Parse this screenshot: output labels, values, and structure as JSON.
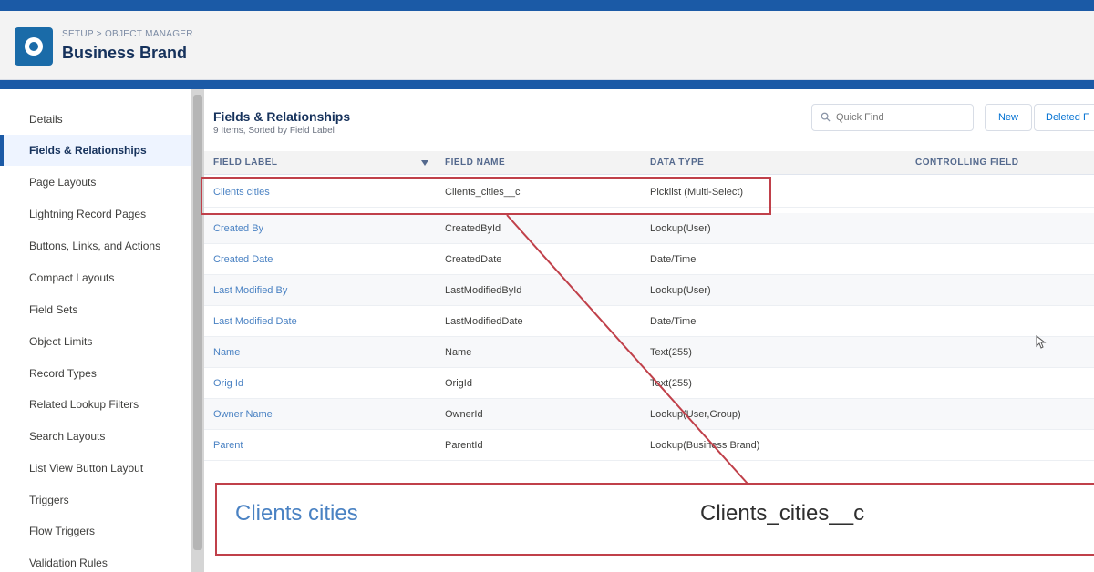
{
  "header": {
    "breadcrumb": "SETUP > OBJECT MANAGER",
    "title": "Business Brand",
    "icon": "object-icon",
    "accent_color": "#1b5aa6"
  },
  "sidebar": {
    "items": [
      {
        "label": "Details"
      },
      {
        "label": "Fields & Relationships",
        "active": true
      },
      {
        "label": "Page Layouts"
      },
      {
        "label": "Lightning Record Pages"
      },
      {
        "label": "Buttons, Links, and Actions"
      },
      {
        "label": "Compact Layouts"
      },
      {
        "label": "Field Sets"
      },
      {
        "label": "Object Limits"
      },
      {
        "label": "Record Types"
      },
      {
        "label": "Related Lookup Filters"
      },
      {
        "label": "Search Layouts"
      },
      {
        "label": "List View Button Layout"
      },
      {
        "label": "Triggers"
      },
      {
        "label": "Flow Triggers"
      },
      {
        "label": "Validation Rules"
      }
    ]
  },
  "main": {
    "section_title": "Fields & Relationships",
    "section_subtitle": "9 Items, Sorted by Field Label",
    "quick_find_placeholder": "Quick Find",
    "new_button": "New",
    "deleted_button": "Deleted F",
    "columns": [
      "FIELD LABEL",
      "FIELD NAME",
      "DATA TYPE",
      "CONTROLLING FIELD"
    ],
    "rows": [
      {
        "label": "Clients cities",
        "name": "Clients_cities__c",
        "type": "Picklist (Multi-Select)"
      },
      {
        "label": "Created By",
        "name": "CreatedById",
        "type": "Lookup(User)"
      },
      {
        "label": "Created Date",
        "name": "CreatedDate",
        "type": "Date/Time"
      },
      {
        "label": "Last Modified By",
        "name": "LastModifiedById",
        "type": "Lookup(User)"
      },
      {
        "label": "Last Modified Date",
        "name": "LastModifiedDate",
        "type": "Date/Time"
      },
      {
        "label": "Name",
        "name": "Name",
        "type": "Text(255)"
      },
      {
        "label": "Orig Id",
        "name": "OrigId",
        "type": "Text(255)"
      },
      {
        "label": "Owner Name",
        "name": "OwnerId",
        "type": "Lookup(User,Group)"
      },
      {
        "label": "Parent",
        "name": "ParentId",
        "type": "Lookup(Business Brand)"
      }
    ]
  },
  "callout": {
    "label": "Clients cities",
    "name": "Clients_cities__c",
    "border_color": "#c0404a"
  }
}
